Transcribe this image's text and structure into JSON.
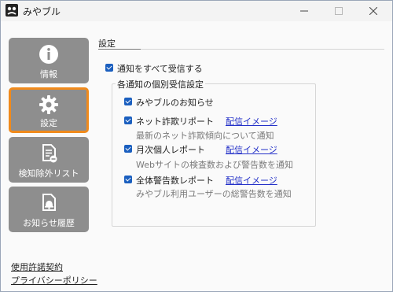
{
  "window": {
    "title": "みやブル",
    "minimize_icon": "minimize-icon",
    "maximize_icon": "maximize-icon",
    "close_icon": "close-icon"
  },
  "sidebar": {
    "items": [
      {
        "label": "情報",
        "icon": "info-icon"
      },
      {
        "label": "設定",
        "icon": "gear-icon",
        "active": true
      },
      {
        "label": "検知除外リスト",
        "icon": "document-minus-icon"
      },
      {
        "label": "お知らせ履歴",
        "icon": "bell-document-icon"
      }
    ],
    "links": [
      "使用許諾契約",
      "プライバシーポリシー"
    ]
  },
  "settings": {
    "section_title": "設定",
    "receive_all_label": "通知をすべて受信する",
    "group_title": "各通知の個別受信設定",
    "items": [
      {
        "label": "みやブルのお知らせ",
        "checked": true,
        "link": "",
        "desc": ""
      },
      {
        "label": "ネット詐欺リポート",
        "checked": true,
        "link": "配信イメージ",
        "desc": "最新のネット詐欺傾向について通知"
      },
      {
        "label": "月次個人レポート",
        "checked": true,
        "link": "配信イメージ",
        "desc": "Webサイトの検査数および警告数を通知"
      },
      {
        "label": "全体警告数レポート",
        "checked": true,
        "link": "配信イメージ",
        "desc": "みやブル利用ユーザーの総警告数を通知"
      }
    ]
  },
  "colors": {
    "accent": "#1b5fbf",
    "active_border": "#f08a1c",
    "sidebar_button": "#8e8e8e",
    "link": "#2330c8"
  }
}
